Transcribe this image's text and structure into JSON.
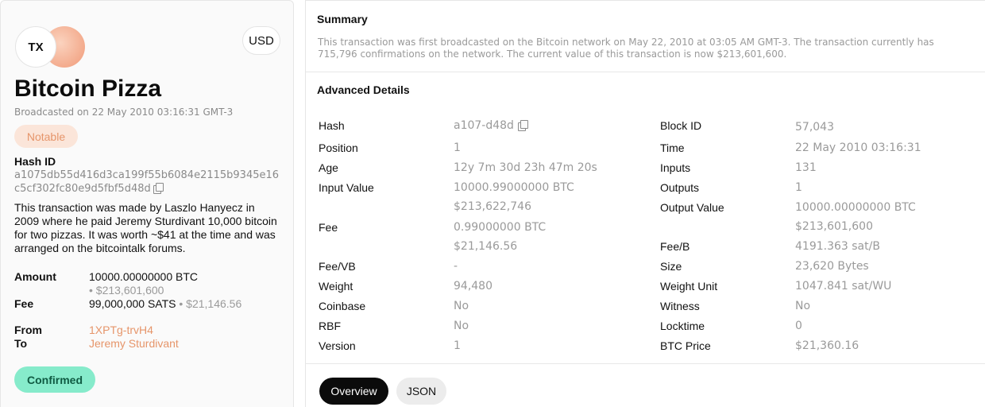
{
  "card": {
    "avatar_text": "TX",
    "currency": "USD",
    "title": "Bitcoin Pizza",
    "broadcast": "Broadcasted on 22 May 2010 03:16:31 GMT-3",
    "badge": "Notable",
    "hash_label": "Hash ID",
    "hash_value": "a1075db55d416d3ca199f55b6084e2115b9345e16c5cf302fc80e9d5fbf5d48d",
    "description": "This transaction was made by Laszlo Hanyecz in 2009 where he paid Jeremy Sturdivant 10,000 bitcoin for two pizzas. It was worth ~$41 at the time and was arranged on the bitcointalk forums.",
    "amount_label": "Amount",
    "amount_value": "10000.00000000 BTC",
    "amount_usd": "• $213,601,600",
    "fee_label": "Fee",
    "fee_value": "99,000,000 SATS",
    "fee_usd": "• $21,146.56",
    "from_label": "From",
    "from_value": "1XPTg-trvH4",
    "to_label": "To",
    "to_value": "Jeremy Sturdivant",
    "status": "Confirmed"
  },
  "summary": {
    "title": "Summary",
    "text": "This transaction was first broadcasted on the Bitcoin network on May 22, 2010 at 03:05 AM GMT-3. The transaction currently has 715,796 confirmations on the network. The current value of this transaction is now $213,601,600."
  },
  "details": {
    "title": "Advanced Details",
    "hash_label": "Hash",
    "hash_value": "a107-d48d",
    "position_label": "Position",
    "position_value": "1",
    "age_label": "Age",
    "age_value": "12y 7m 30d 23h 47m 20s",
    "input_value_label": "Input Value",
    "input_value_btc": "10000.99000000 BTC",
    "input_value_usd": "$213,622,746",
    "fee_label": "Fee",
    "fee_btc": "0.99000000 BTC",
    "fee_usd": "$21,146.56",
    "feevb_label": "Fee/VB",
    "feevb_value": "-",
    "weight_label": "Weight",
    "weight_value": "94,480",
    "coinbase_label": "Coinbase",
    "coinbase_value": "No",
    "rbf_label": "RBF",
    "rbf_value": "No",
    "version_label": "Version",
    "version_value": "1",
    "block_label": "Block ID",
    "block_value": "57,043",
    "time_label": "Time",
    "time_value": "22 May 2010 03:16:31",
    "inputs_label": "Inputs",
    "inputs_value": "131",
    "outputs_label": "Outputs",
    "outputs_value": "1",
    "output_value_label": "Output Value",
    "output_value_btc": "10000.00000000 BTC",
    "output_value_usd": "$213,601,600",
    "feeb_label": "Fee/B",
    "feeb_value": "4191.363 sat/B",
    "size_label": "Size",
    "size_value": "23,620 Bytes",
    "weight_unit_label": "Weight Unit",
    "weight_unit_value": "1047.841 sat/WU",
    "witness_label": "Witness",
    "witness_value": "No",
    "locktime_label": "Locktime",
    "locktime_value": "0",
    "btc_price_label": "BTC Price",
    "btc_price_value": "$21,360.16"
  },
  "tabs": {
    "overview": "Overview",
    "json": "JSON"
  },
  "colors": {
    "accent_orange": "#e6956a",
    "confirmed_bg": "#86ebcb",
    "notable_bg": "#fbe5d9"
  }
}
